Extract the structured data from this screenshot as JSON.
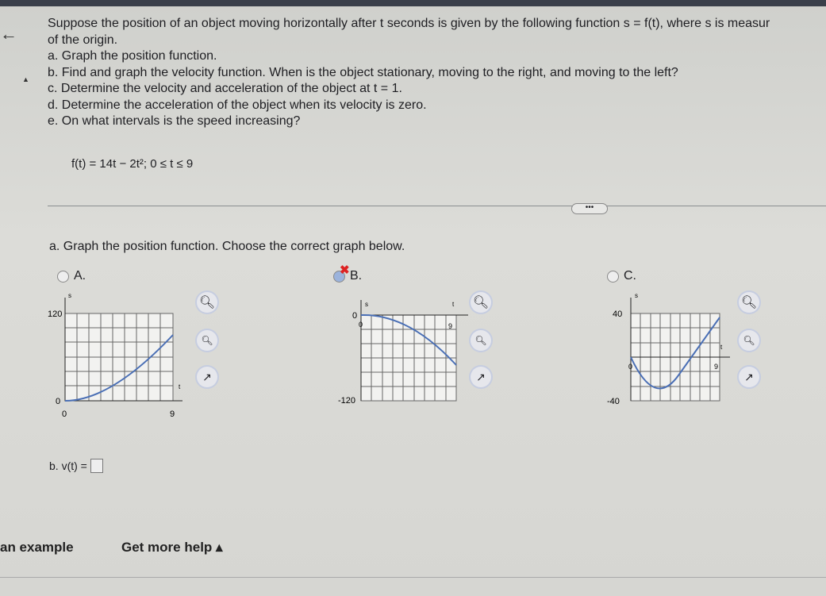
{
  "question": {
    "intro_line1": "Suppose the position of an object moving horizontally after t seconds is given by the following function s = f(t), where s is measur",
    "intro_line2": "of the origin.",
    "parts": [
      "a. Graph the position function.",
      "b. Find and graph the velocity function. When is the object stationary, moving to the right, and moving to the left?",
      "c. Determine the velocity and acceleration of the object at t = 1.",
      "d. Determine the acceleration of the object when its velocity is zero.",
      "e. On what intervals is the speed increasing?"
    ],
    "function": "f(t) = 14t − 2t²; 0 ≤ t ≤ 9"
  },
  "more_button": "•••",
  "part_a": {
    "prompt": "a. Graph the position function. Choose the correct graph below.",
    "options": [
      {
        "label": "A.",
        "selected": false,
        "y_top": "120",
        "y_bottom": "0",
        "x_left": "0",
        "x_right": "9",
        "x_axis": "t",
        "y_axis": "s"
      },
      {
        "label": "B.",
        "selected": true,
        "marked_incorrect": true,
        "y_top": "0",
        "y_bottom": "-120",
        "x_left": "0",
        "x_right": "9",
        "x_axis": "t",
        "y_axis": "s"
      },
      {
        "label": "C.",
        "selected": false,
        "y_top": "40",
        "y_bottom": "-40",
        "x_left": "0",
        "x_right": "9",
        "x_axis": "t",
        "y_axis": "s"
      }
    ]
  },
  "part_b": {
    "label": "b. v(t) =",
    "answer": ""
  },
  "footer": {
    "example": "an example",
    "help": "Get more help ▴"
  },
  "colors": {
    "curve": "#4a6fb5",
    "incorrect": "#dd2222"
  }
}
